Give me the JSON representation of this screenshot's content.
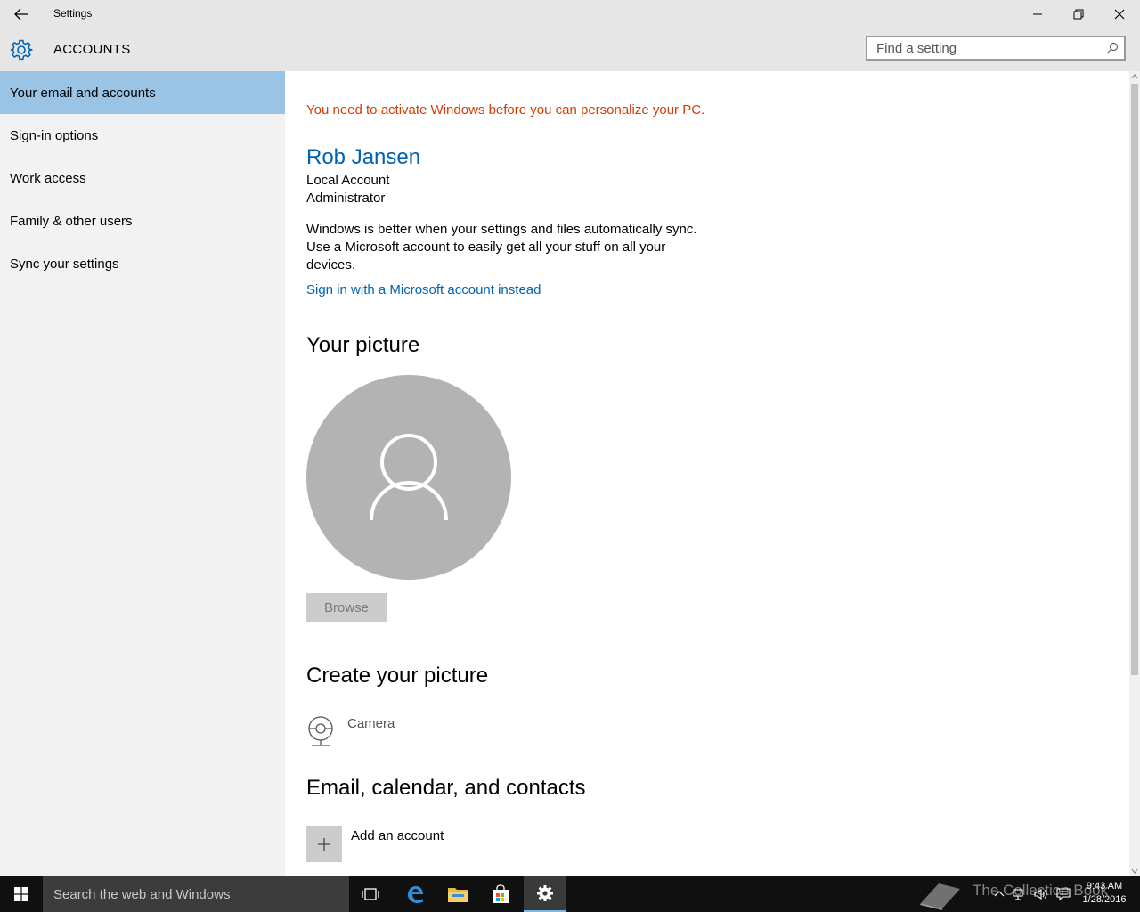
{
  "window": {
    "title": "Settings"
  },
  "header": {
    "section_title": "ACCOUNTS",
    "search_placeholder": "Find a setting"
  },
  "sidebar": {
    "items": [
      {
        "label": "Your email and accounts",
        "active": true
      },
      {
        "label": "Sign-in options"
      },
      {
        "label": "Work access"
      },
      {
        "label": "Family & other users"
      },
      {
        "label": "Sync your settings"
      }
    ]
  },
  "main": {
    "activation_warning": "You need to activate Windows before you can personalize your PC.",
    "user": {
      "name": "Rob Jansen",
      "account_type": "Local Account",
      "role": "Administrator"
    },
    "sync_message": "Windows is better when your settings and files automatically sync. Use a Microsoft account to easily get all your stuff on all your devices.",
    "sign_in_link": "Sign in with a Microsoft account instead",
    "picture_title": "Your picture",
    "browse_label": "Browse",
    "create_picture_title": "Create your picture",
    "camera_label": "Camera",
    "email_section_title": "Email, calendar, and contacts",
    "add_account_label": "Add an account"
  },
  "taskbar": {
    "search_text": "Search the web and Windows",
    "time": "9:43 AM",
    "date": "1/28/2016",
    "watermark": "The Collection Book"
  },
  "colors": {
    "accent": "#0063b1",
    "warning": "#d83b01",
    "active_nav": "#99c4e6"
  }
}
